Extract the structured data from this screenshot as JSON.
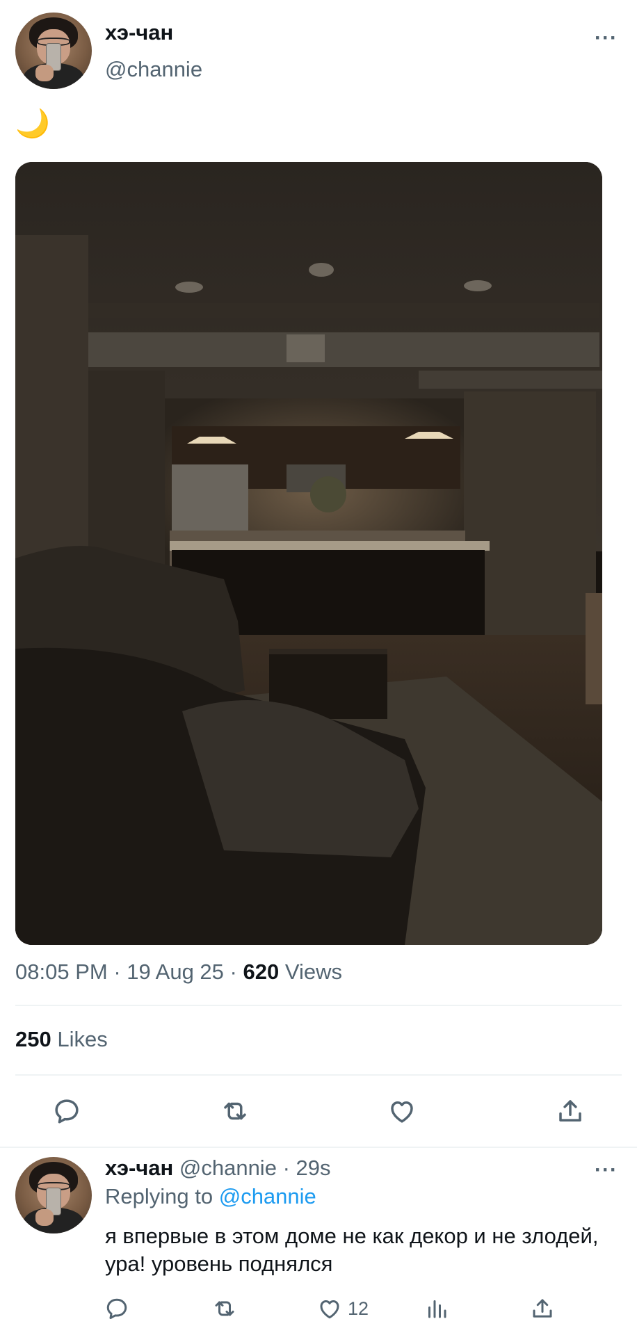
{
  "tweet": {
    "author_name": "хэ-чан",
    "author_handle": "@channie",
    "text": "🌙",
    "time": "08:05 PM",
    "date": "19 Aug 25",
    "views_count": "620",
    "views_label": "Views",
    "likes_count": "250",
    "likes_label": "Likes",
    "more_icon": "···"
  },
  "reply": {
    "author_name": "хэ-чан",
    "author_handle": "@channie",
    "age": "29s",
    "replying_label": "Replying to",
    "replying_handle": "@channie",
    "text": "я впервые в этом доме не как декор и не злодей, ура! уровень поднялся",
    "like_count": "12",
    "more_icon": "···"
  },
  "icons": {
    "reply": "reply-icon",
    "retweet": "retweet-icon",
    "like": "heart-icon",
    "share": "share-icon",
    "views": "views-icon",
    "more": "more-icon"
  },
  "colors": {
    "text_primary": "#0f1419",
    "text_secondary": "#536471",
    "link": "#1d9bf0",
    "divider": "#eff3f4"
  }
}
